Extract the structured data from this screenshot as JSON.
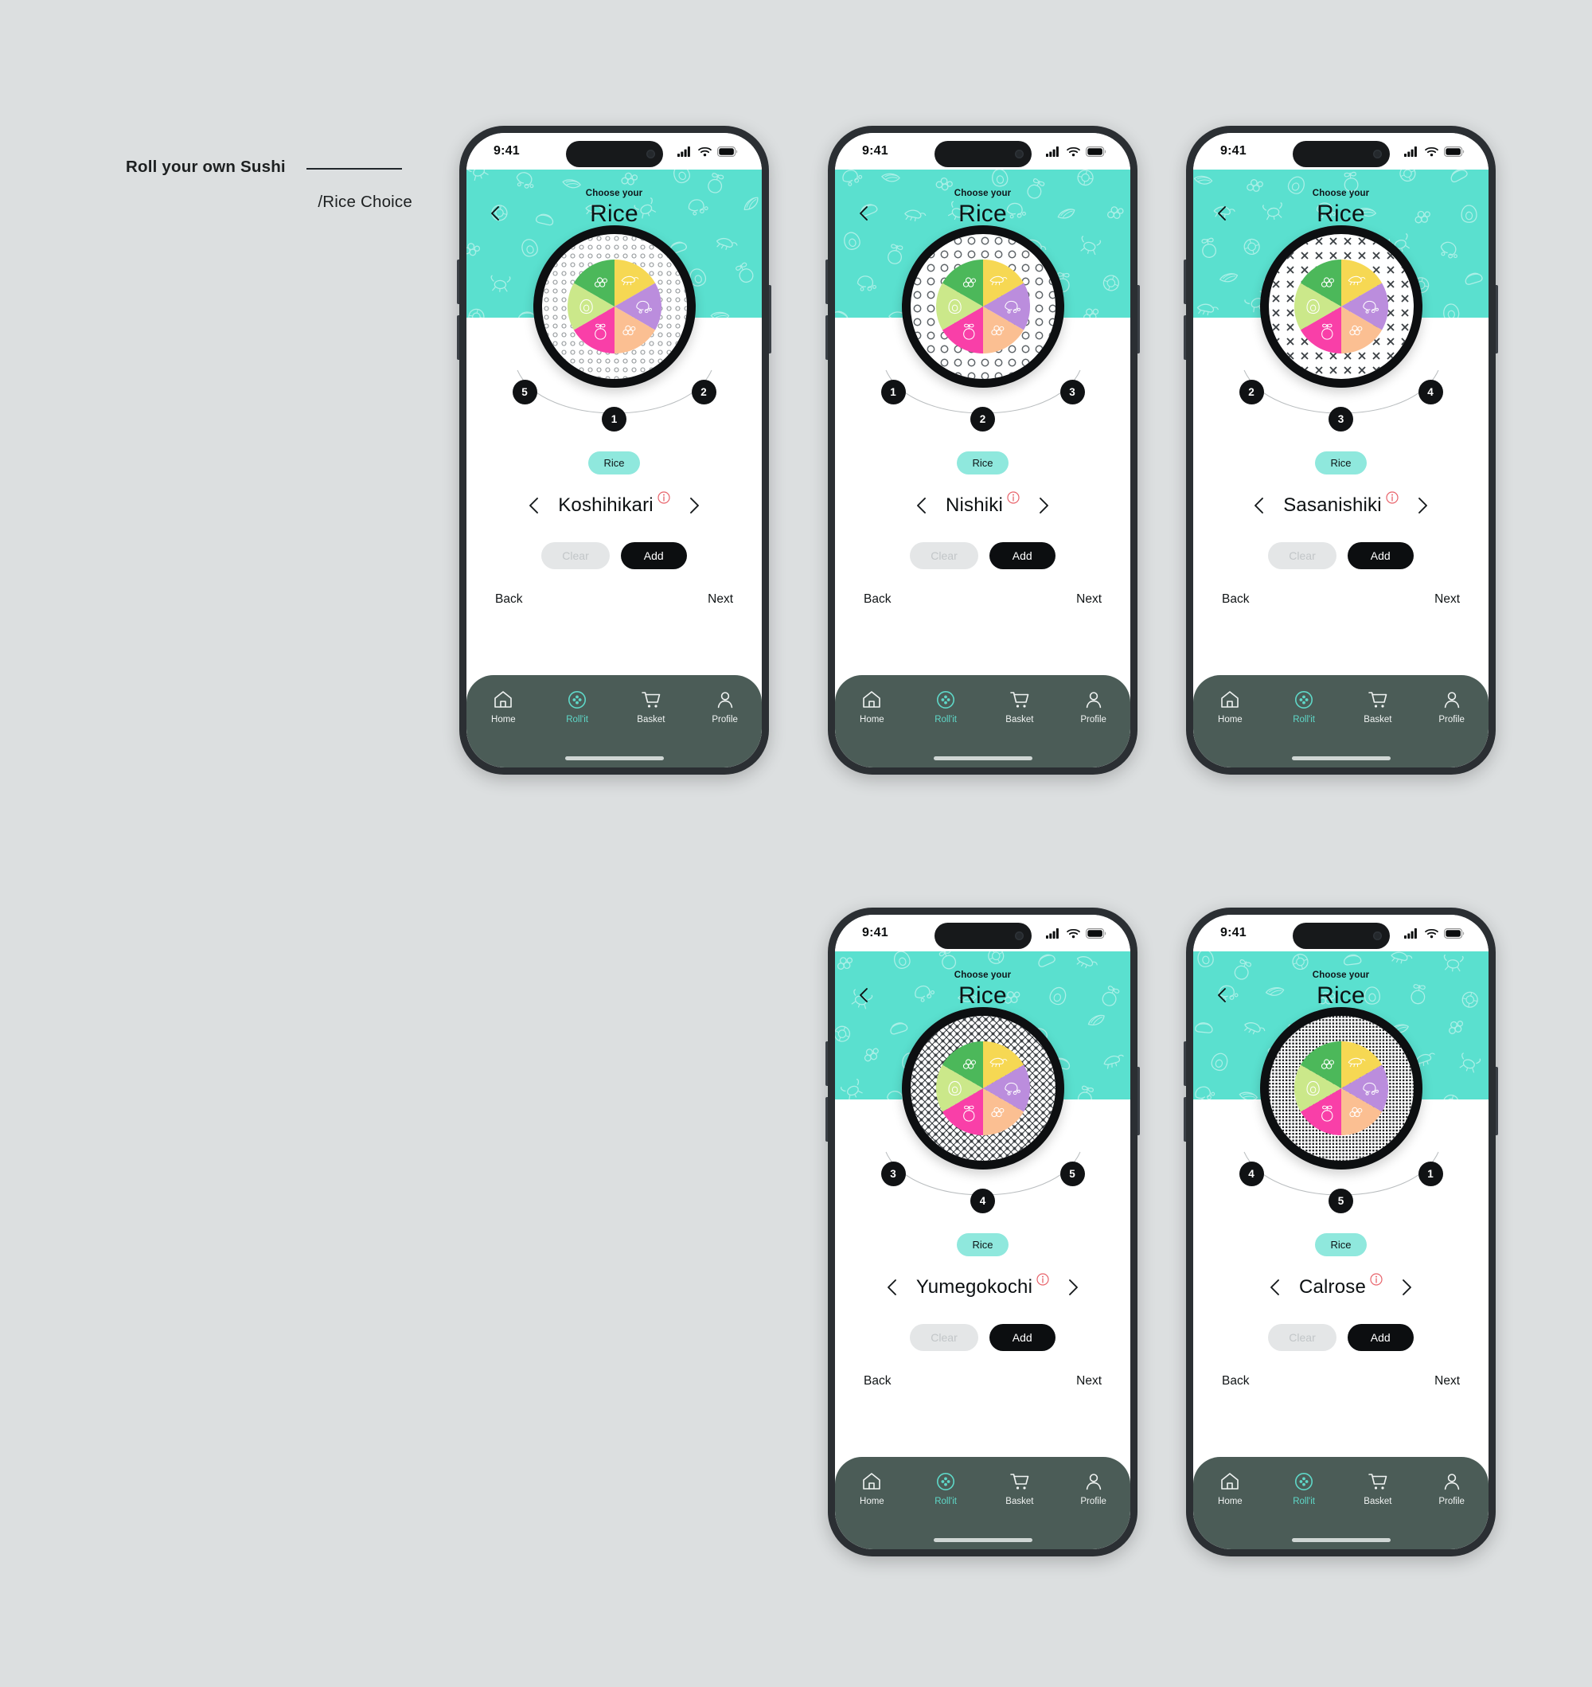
{
  "caption": {
    "line1": "Roll your own Sushi",
    "line2": "/Rice Choice"
  },
  "colors": {
    "page_bg": "#dcdfe0",
    "header_teal": "#5ae0cf",
    "chip_teal": "#8fe8dd",
    "tabbar": "#4b5c57",
    "accent_active": "#5fd8c8",
    "dark": "#0c0e10",
    "info_red": "#e8636b",
    "clear_bg": "#e4e6e7",
    "clear_text": "#c2c6c8"
  },
  "statusbar": {
    "time": "9:41",
    "icons": [
      "signal-icon",
      "wifi-icon",
      "battery-icon"
    ]
  },
  "header": {
    "back_icon": "back-chevron-icon",
    "eyebrow": "Choose your",
    "title": "Rice",
    "pattern_icons": [
      "shrimp",
      "crab",
      "octopus",
      "salmon-slice",
      "roe",
      "avocado",
      "radish",
      "maki-roll",
      "nigiri"
    ]
  },
  "wheel": {
    "segments": [
      {
        "name": "shrimp",
        "color": "#f6d853",
        "icon": "shrimp-icon"
      },
      {
        "name": "octopus",
        "color": "#bb8ddd",
        "icon": "octopus-icon"
      },
      {
        "name": "roe",
        "color": "#fbbf92",
        "icon": "roe-icon"
      },
      {
        "name": "radish",
        "color": "#f93fa8",
        "icon": "radish-icon"
      },
      {
        "name": "avocado",
        "color": "#cbe88a",
        "icon": "avocado-icon"
      },
      {
        "name": "edamame",
        "color": "#4cb85a",
        "icon": "edamame-icon"
      }
    ]
  },
  "chip_label": "Rice",
  "buttons": {
    "clear": "Clear",
    "add": "Add",
    "back": "Back",
    "next": "Next",
    "prev_icon": "chevron-left-icon",
    "next_icon": "chevron-right-icon",
    "info_icon": "info-icon"
  },
  "tabbar": {
    "items": [
      {
        "label": "Home",
        "icon": "home-icon",
        "active": false
      },
      {
        "label": "Roll'it",
        "icon": "rollit-icon",
        "active": true
      },
      {
        "label": "Basket",
        "icon": "basket-icon",
        "active": false
      },
      {
        "label": "Profile",
        "icon": "profile-icon",
        "active": false
      }
    ]
  },
  "phones": [
    {
      "rice_name": "Koshihikari",
      "plate_texture": "small-open-dots",
      "steps": {
        "left": "5",
        "center": "1",
        "right": "2"
      }
    },
    {
      "rice_name": "Nishiki",
      "plate_texture": "large-open-rings",
      "steps": {
        "left": "1",
        "center": "2",
        "right": "3"
      }
    },
    {
      "rice_name": "Sasanishiki",
      "plate_texture": "cross-marks",
      "steps": {
        "left": "2",
        "center": "3",
        "right": "4"
      }
    },
    {
      "rice_name": "Yumegokochi",
      "plate_texture": "diagonal-lattice",
      "steps": {
        "left": "3",
        "center": "4",
        "right": "5"
      }
    },
    {
      "rice_name": "Calrose",
      "plate_texture": "dense-dot-grid",
      "steps": {
        "left": "4",
        "center": "5",
        "right": "1"
      }
    }
  ]
}
